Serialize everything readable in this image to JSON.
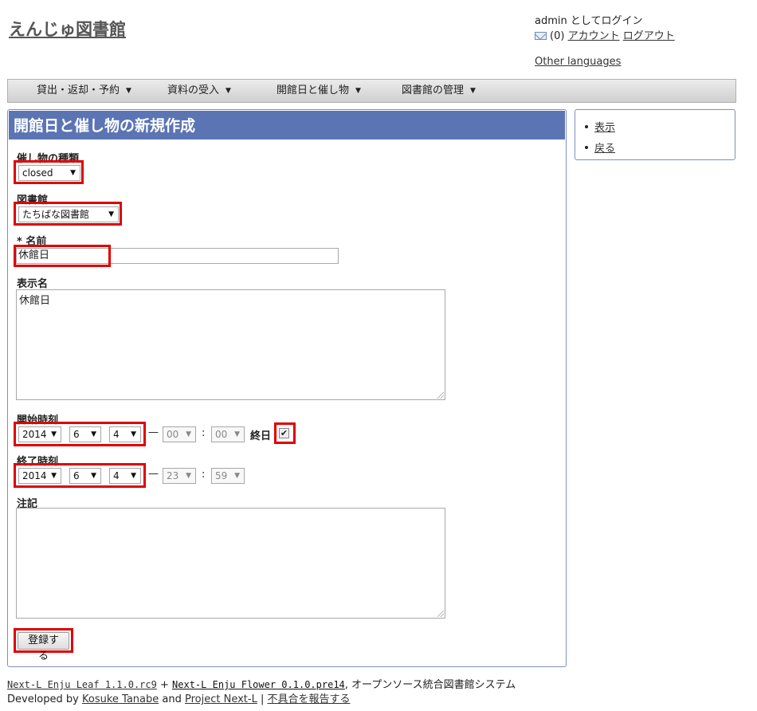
{
  "header": {
    "site_title": "えんじゅ図書館",
    "login_status": "admin としてログイン",
    "message_count": "(0)",
    "account_link": "アカウント",
    "logout_link": "ログアウト",
    "other_languages": "Other languages"
  },
  "menu": [
    {
      "label": "貸出・返却・予約"
    },
    {
      "label": "資料の受入"
    },
    {
      "label": "開館日と催し物"
    },
    {
      "label": "図書館の管理"
    }
  ],
  "form": {
    "title": "開館日と催し物の新規作成",
    "event_category_label": "催し物の種類",
    "event_category_value": "closed",
    "library_label": "図書館",
    "library_value": "たちばな図書館",
    "name_label": "* 名前",
    "name_value": "休館日",
    "display_name_label": "表示名",
    "display_name_value": "休館日",
    "start_label": "開始時刻",
    "start_year": "2014",
    "start_month": "6",
    "start_day": "4",
    "start_hour": "00",
    "start_minute": "00",
    "all_day_label": "終日",
    "end_label": "終了時刻",
    "end_year": "2014",
    "end_month": "6",
    "end_day": "4",
    "end_hour": "23",
    "end_minute": "59",
    "dash": "—",
    "colon": ":",
    "note_label": "注記",
    "note_value": "",
    "submit_label": "登録する"
  },
  "sidebar": {
    "items": [
      {
        "label": "表示"
      },
      {
        "label": "戻る"
      }
    ]
  },
  "footer": {
    "leaf_link": "Next-L Enju Leaf 1.1.0.rc9",
    "plus": "+",
    "flower_link": "Next-L Enju Flower 0.1.0.pre14",
    "tagline": ", オープンソース統合図書館システム",
    "developed_by": "Developed by",
    "author_link": "Kosuke Tanabe",
    "and": "and",
    "project_link": "Project Next-L",
    "pipe": "|",
    "report_link": "不具合を報告する"
  },
  "colors": {
    "title_bar": "#5b74b4",
    "highlight": "#e00000",
    "panel_border": "#7d8fb9"
  }
}
